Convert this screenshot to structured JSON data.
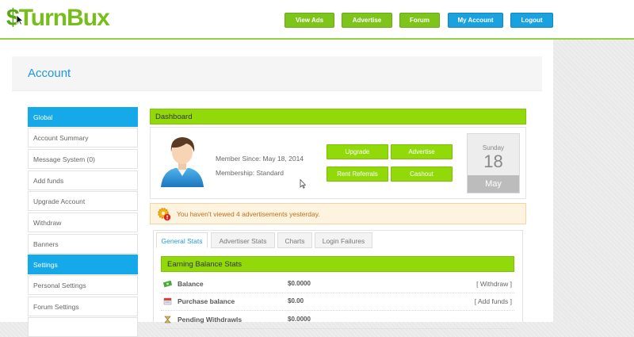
{
  "header": {
    "logo_symbol": "$",
    "logo_text": "TurnBux",
    "nav": [
      "View Ads",
      "Advertise",
      "Forum",
      "My Account",
      "Logout"
    ]
  },
  "page": {
    "title": "Account"
  },
  "sidebar": {
    "items": [
      {
        "label": "Global",
        "header": true
      },
      {
        "label": "Account Summary"
      },
      {
        "label": "Message System (0)"
      },
      {
        "label": "Add funds"
      },
      {
        "label": "Upgrade Account"
      },
      {
        "label": "Withdraw"
      },
      {
        "label": "Banners"
      },
      {
        "label": "Settings",
        "header": true
      },
      {
        "label": "Personal Settings"
      },
      {
        "label": "Forum Settings"
      }
    ]
  },
  "dashboard": {
    "title": "Dashboard",
    "member_since": "Member Since: May 18, 2014",
    "membership": "Membership: Standard",
    "buttons": [
      "Upgrade",
      "Advertise",
      "Rent Referrals",
      "Cashout"
    ],
    "calendar": {
      "weekday": "Sunday",
      "day": "18",
      "month": "May"
    }
  },
  "alert": {
    "text": "You haven't viewed 4 advertisements yesterday."
  },
  "tabs": [
    "General Stats",
    "Advertiser Stats",
    "Charts",
    "Login Failures"
  ],
  "earning": {
    "title": "Earning Balance Stats",
    "rows": [
      {
        "label": "Balance",
        "value": "$0.0000",
        "action": "[ Withdraw ]"
      },
      {
        "label": "Purchase balance",
        "value": "$0.00",
        "action": "[ Add funds ]"
      },
      {
        "label": "Pending Withdrawls",
        "value": "$0.0000",
        "action": ""
      }
    ]
  },
  "colors": {
    "green": "#92d90a",
    "blue": "#15a9ea",
    "link_blue": "#1c9ad6",
    "alert_text": "#c2701b"
  }
}
